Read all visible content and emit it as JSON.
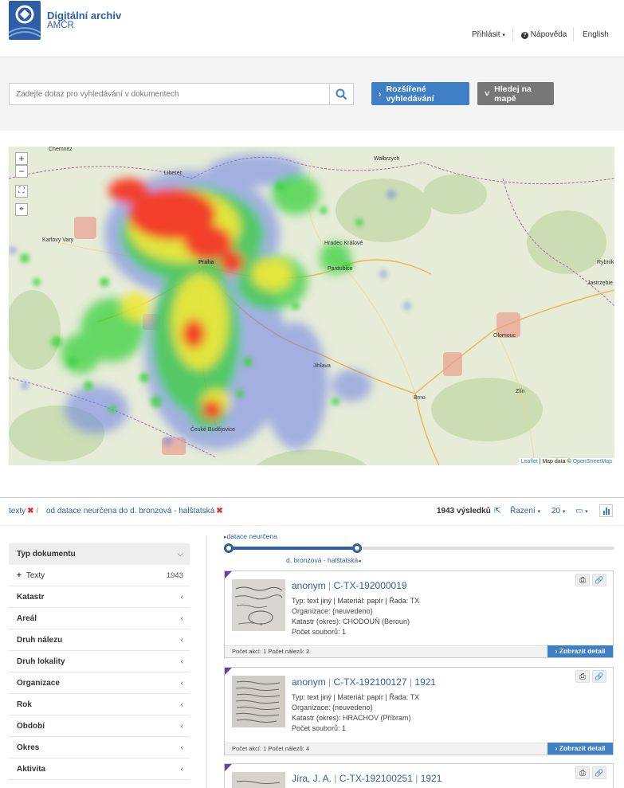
{
  "header": {
    "brand_line1": "Digitální archiv",
    "brand_line2": "AMČR",
    "login": "Přihlásit",
    "help": "Nápověda",
    "language": "English"
  },
  "search": {
    "placeholder": "Zadejte dotaz pro vyhledávání v dokumentech",
    "advanced_label": "Rozšířené vyhledávání",
    "map_label": "Hledej na mapě"
  },
  "map": {
    "zoom_in": "+",
    "zoom_out": "−",
    "attribution_leaflet": "Leaflet",
    "attribution_text": "| Map data ©",
    "attribution_osm": "OpenStreetMap",
    "cities": [
      "Chemnitz",
      "Liberec",
      "Wałbrzych",
      "Praha",
      "Hradec Králové",
      "Pardubice",
      "Karlovy Vary",
      "Jihlava",
      "Brno",
      "Olomouc",
      "Zlín",
      "České Budějovice",
      "Rybnik",
      "Jastrzębie"
    ]
  },
  "filters": {
    "chip1": "texty",
    "chip2": "od datace neurčena do d. bronzová - halštatská",
    "result_count": "1943 výsledků",
    "sort_label": "Řazení",
    "per_page": "20"
  },
  "timeline": {
    "start_label": "datace neurčena",
    "end_label": "d. bronzová - halštatská"
  },
  "sidebar": {
    "head": "Typ dokumentu",
    "sub_label": "Texty",
    "sub_count": "1943",
    "facets": [
      "Katastr",
      "Areál",
      "Druh nálezu",
      "Druh lokality",
      "Organizace",
      "Rok",
      "Období",
      "Okres",
      "Aktivita"
    ]
  },
  "results": [
    {
      "author": "anonym",
      "id": "C-TX-192000019",
      "year": "",
      "type_line": "Typ: text jiný | Materiál: papír | Řada: TX",
      "org_line": "Organizace: {neuvedeno}",
      "katastr_line": "Katastr (okres): CHODOUŇ (Beroun)",
      "files_line": "Počet souborů: 1",
      "footer": "Počet akcí: 1  Počet nálezů: 2",
      "detail": "Zobrazit detail"
    },
    {
      "author": "anonym",
      "id": "C-TX-192100127",
      "year": "1921",
      "type_line": "Typ: text jiný | Materiál: papír | Řada: TX",
      "org_line": "Organizace: {neuvedeno}",
      "katastr_line": "Katastr (okres): HRACHOV (Příbram)",
      "files_line": "Počet souborů: 1",
      "footer": "Počet akcí: 1  Počet nálezů: 4",
      "detail": "Zobrazit detail"
    },
    {
      "author": "Jíra, J. A.",
      "id": "C-TX-192100251",
      "year": "1921"
    }
  ]
}
